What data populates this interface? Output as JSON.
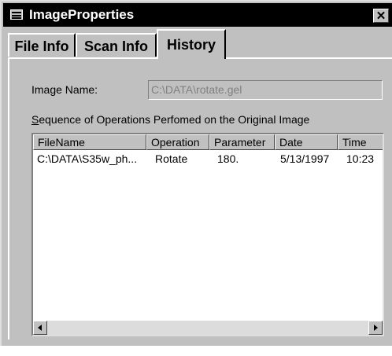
{
  "window": {
    "title": "ImageProperties",
    "close_glyph": "✕"
  },
  "tabs": [
    {
      "label": "File Info"
    },
    {
      "label": "Scan Info"
    },
    {
      "label": "History",
      "active": true
    }
  ],
  "history": {
    "image_name_label": "Image Name:",
    "image_name_value": "C:\\DATA\\rotate.gel",
    "sequence_label_accel": "S",
    "sequence_label_rest": "equence of Operations Perfomed on the Original Image",
    "columns": [
      "FileName",
      "Operation",
      "Parameter",
      "Date",
      "Time"
    ],
    "rows": [
      [
        "C:\\DATA\\S35w_ph...",
        "Rotate",
        "180.",
        "5/13/1997",
        "10:23"
      ]
    ]
  },
  "icons": {
    "window_icon": "window-menu-icon",
    "close": "close-icon",
    "scroll_left": "scroll-left-arrow-icon",
    "scroll_right": "scroll-right-arrow-icon"
  }
}
